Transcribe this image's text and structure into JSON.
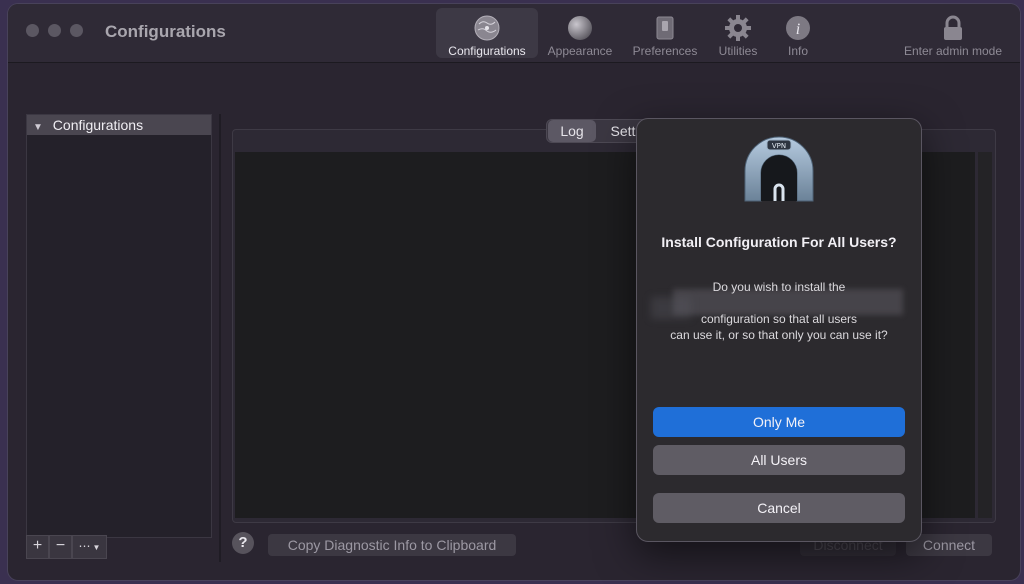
{
  "window": {
    "title": "Configurations"
  },
  "toolbar": {
    "items": [
      {
        "label": "Configurations",
        "icon": "globe-icon",
        "active": true
      },
      {
        "label": "Appearance",
        "icon": "sphere-icon",
        "active": false
      },
      {
        "label": "Preferences",
        "icon": "switch-icon",
        "active": false
      },
      {
        "label": "Utilities",
        "icon": "gear-icon",
        "active": false
      },
      {
        "label": "Info",
        "icon": "info-icon",
        "active": false
      }
    ],
    "admin_label": "Enter admin mode"
  },
  "sidebar": {
    "header": "Configurations",
    "buttons": {
      "add": "+",
      "remove": "−",
      "actions": "⋯"
    }
  },
  "tabs": {
    "log": "Log",
    "settings": "Sett"
  },
  "buttons": {
    "help": "?",
    "copy_diagnostic": "Copy Diagnostic Info to Clipboard",
    "disconnect": "Disconnect",
    "connect": "Connect"
  },
  "dialog": {
    "icon_label": "VPN",
    "title": "Install Configuration For All Users?",
    "message_line1": "Do you wish to install the",
    "message_line2": "configuration so that all users",
    "message_line3": "can use it, or so that only you can use it?",
    "only_me": "Only Me",
    "all_users": "All Users",
    "cancel": "Cancel"
  },
  "colors": {
    "accent": "#1f6fd8",
    "window_bg": "#2a2530",
    "desktop_bg": "#3a3050"
  }
}
